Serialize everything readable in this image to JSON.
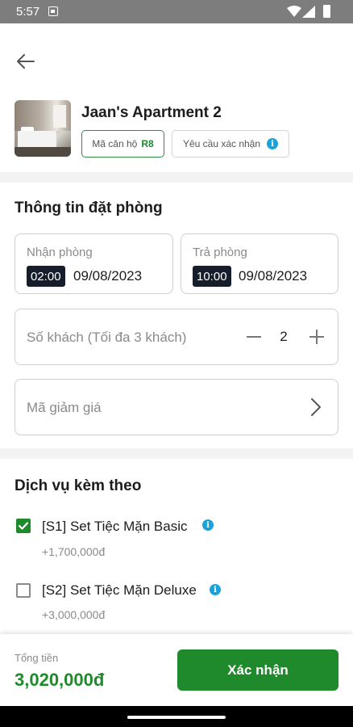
{
  "status_bar": {
    "time": "5:57"
  },
  "header": {
    "back_icon": "arrow-left-icon"
  },
  "apartment": {
    "title": "Jaan's Apartment 2",
    "code_label": "Mã căn hộ",
    "code_value": "R8",
    "confirm_label": "Yêu cầu xác nhận",
    "info_icon": "i"
  },
  "booking_info": {
    "title": "Thông tin đặt phòng",
    "checkin": {
      "label": "Nhận phòng",
      "time": "02:00",
      "date": "09/08/2023"
    },
    "checkout": {
      "label": "Trả phòng",
      "time": "10:00",
      "date": "09/08/2023"
    },
    "guests": {
      "label": "Số khách (Tối đa 3 khách)",
      "value": "2"
    },
    "coupon": {
      "label": "Mã giảm giá"
    }
  },
  "services": {
    "title": "Dịch vụ kèm theo",
    "items": [
      {
        "name": "[S1] Set Tiệc Mặn Basic",
        "price": "+1,700,000đ",
        "checked": true
      },
      {
        "name": "[S2] Set Tiệc Mặn Deluxe",
        "price": "+3,000,000đ",
        "checked": false
      }
    ]
  },
  "footer": {
    "total_label": "Tổng tiền",
    "total_value": "3,020,000đ",
    "confirm_button": "Xác nhận"
  },
  "colors": {
    "primary": "#1e8a2b",
    "info": "#1aa3d9",
    "time_badge": "#161d2b"
  }
}
